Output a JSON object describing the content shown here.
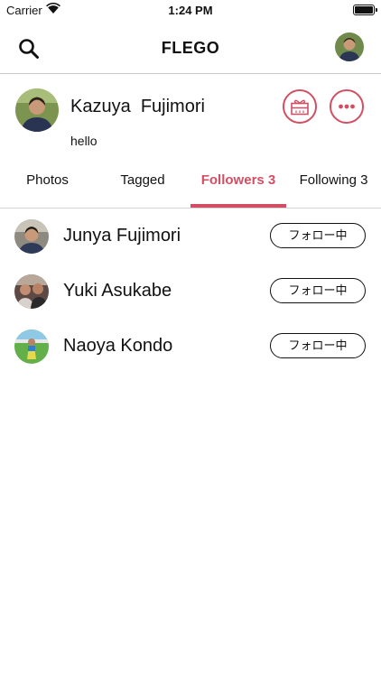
{
  "status_bar": {
    "carrier": "Carrier",
    "time": "1:24 PM"
  },
  "nav": {
    "title": "FLEGO"
  },
  "profile": {
    "name": "Kazuya  Fujimori",
    "bio": "hello"
  },
  "tabs": [
    {
      "label": "Photos",
      "active": false
    },
    {
      "label": "Tagged",
      "active": false
    },
    {
      "label": "Followers 3",
      "active": true
    },
    {
      "label": "Following 3",
      "active": false
    }
  ],
  "followers": [
    {
      "name": "Junya Fujimori",
      "button": "フォロー中"
    },
    {
      "name": "Yuki Asukabe",
      "button": "フォロー中"
    },
    {
      "name": "Naoya Kondo",
      "button": "フォロー中"
    }
  ],
  "colors": {
    "accent": "#d24f63",
    "divider": "#c9c9c9"
  },
  "icons": [
    "wifi-icon",
    "battery-icon",
    "search-icon",
    "gift-icon",
    "more-icon"
  ]
}
